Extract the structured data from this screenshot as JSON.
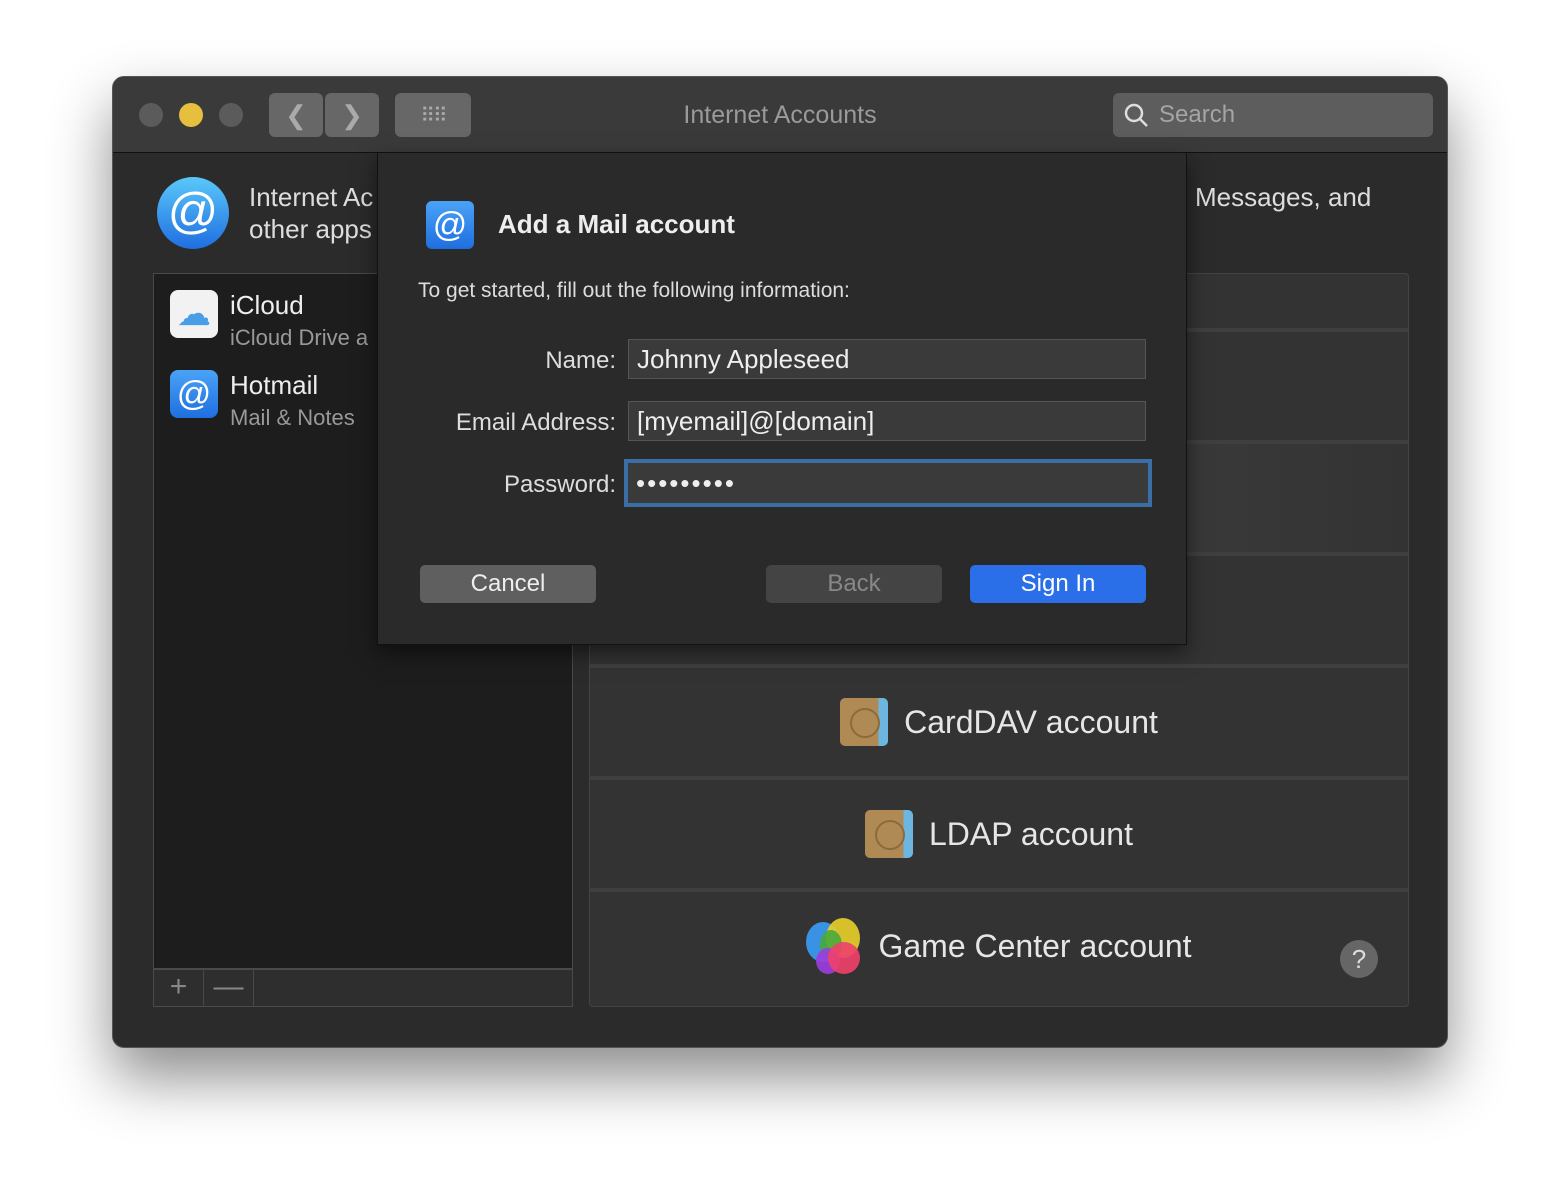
{
  "window": {
    "title": "Internet Accounts",
    "search_placeholder": "Search",
    "colors": {
      "accent": "#2a6ee8",
      "minimize": "#e6bf3e"
    }
  },
  "header": {
    "line1": "Internet Ac",
    "line2": "other apps",
    "right_text": "Messages, and"
  },
  "accounts": [
    {
      "name": "iCloud",
      "detail": "iCloud Drive a",
      "icon": "icloud-icon"
    },
    {
      "name": "Hotmail",
      "detail": "Mail & Notes",
      "icon": "at-icon"
    }
  ],
  "list_controls": {
    "add": "+",
    "remove": "—"
  },
  "providers": [
    {
      "label": "CardDAV account",
      "icon": "contacts-book-icon"
    },
    {
      "label": "LDAP account",
      "icon": "contacts-book-icon"
    },
    {
      "label": "Game Center account",
      "icon": "game-center-icon"
    }
  ],
  "help": "?",
  "dialog": {
    "title": "Add a Mail account",
    "intro": "To get started, fill out the following information:",
    "name_label": "Name:",
    "name_value": "Johnny Appleseed",
    "email_label": "Email Address:",
    "email_value": "[myemail]@[domain]",
    "password_label": "Password:",
    "password_value": "•••••••••",
    "cancel": "Cancel",
    "back": "Back",
    "sign_in": "Sign In"
  }
}
